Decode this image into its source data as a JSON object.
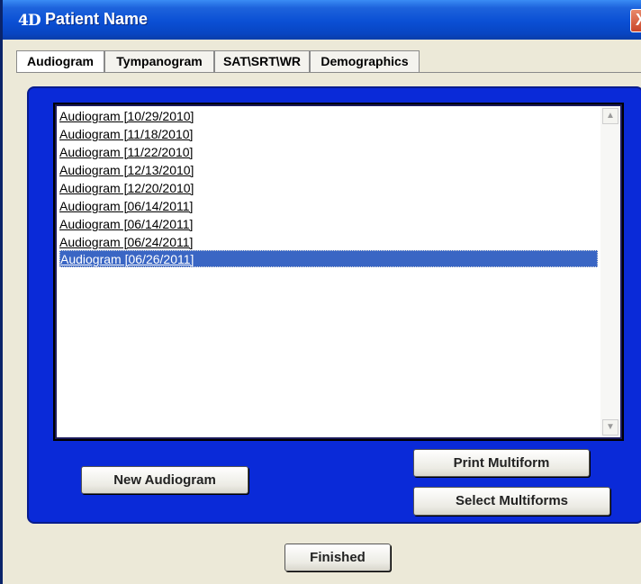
{
  "window": {
    "title": "Patient Name",
    "app_icon": "4D",
    "close_label": "X"
  },
  "tabs": [
    {
      "label": "Audiogram",
      "active": true
    },
    {
      "label": "Tympanogram",
      "active": false
    },
    {
      "label": "SAT\\SRT\\WR",
      "active": false
    },
    {
      "label": "Demographics",
      "active": false
    }
  ],
  "audiogram_list": {
    "items": [
      "Audiogram  [10/29/2010]",
      "Audiogram  [11/18/2010]",
      "Audiogram  [11/22/2010]",
      "Audiogram  [12/13/2010]",
      "Audiogram  [12/20/2010]",
      "Audiogram  [06/14/2011]",
      "Audiogram  [06/14/2011]",
      "Audiogram  [06/24/2011]",
      "Audiogram  [06/26/2011]"
    ],
    "selected_index": 8
  },
  "buttons": {
    "new_audiogram": "New Audiogram",
    "print_multiform": "Print Multiform",
    "select_multiforms": "Select Multiforms",
    "finished": "Finished"
  },
  "colors": {
    "panel_blue": "#0a2ad8",
    "title_blue": "#0a4fd4",
    "selection": "#3a66c4"
  }
}
